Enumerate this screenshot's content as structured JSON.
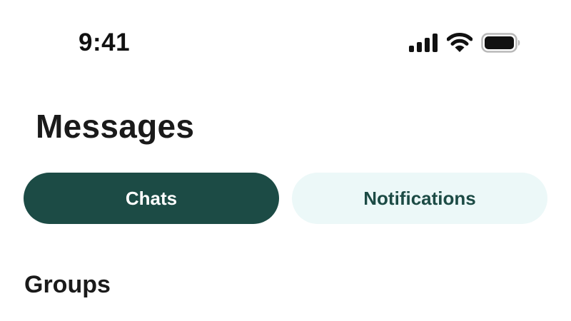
{
  "status_bar": {
    "time": "9:41",
    "icons": [
      "cellular-signal-icon",
      "wifi-icon",
      "battery-icon"
    ]
  },
  "header": {
    "title": "Messages"
  },
  "tabs": [
    {
      "label": "Chats",
      "selected": true
    },
    {
      "label": "Notifications",
      "selected": false
    }
  ],
  "sections": {
    "groups_heading": "Groups"
  },
  "colors": {
    "primary": "#1c4b45",
    "tab_inactive_bg": "#ecf8f8",
    "text": "#1a1a1a",
    "background": "#ffffff"
  }
}
